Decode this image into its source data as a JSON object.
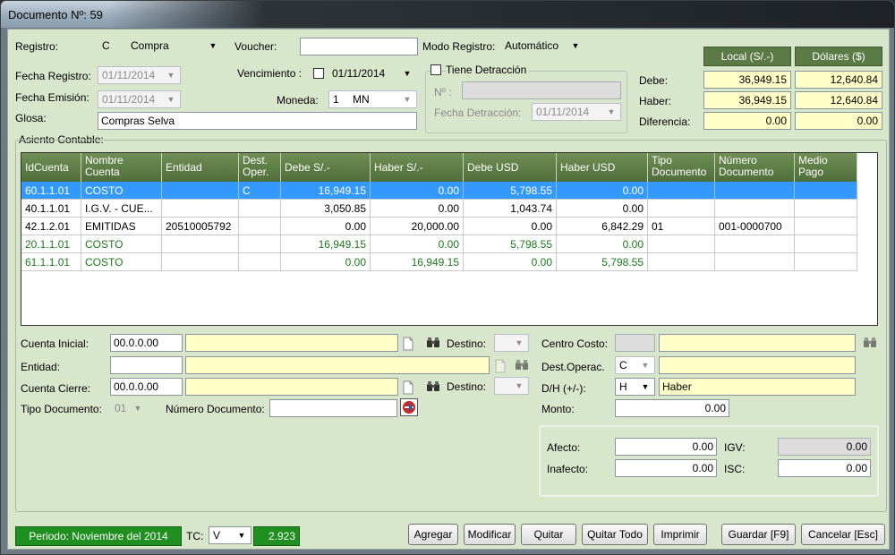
{
  "window": {
    "title": "Documento Nº: 59"
  },
  "header": {
    "registro_label": "Registro:",
    "registro_code": "C",
    "registro_value": "Compra",
    "voucher_label": "Voucher:",
    "voucher_value": "",
    "modo_label": "Modo Registro:",
    "modo_value": "Automático",
    "fecha_registro_label": "Fecha Registro:",
    "fecha_registro_value": "01/11/2014",
    "vencimiento_label": "Vencimiento :",
    "vencimiento_value": "01/11/2014",
    "fecha_emision_label": "Fecha Emisión:",
    "fecha_emision_value": "01/11/2014",
    "moneda_label": "Moneda:",
    "moneda_code": "1",
    "moneda_value": "MN",
    "glosa_label": "Glosa:",
    "glosa_value": "Compras Selva",
    "detraccion_label": "Tiene Detracción",
    "detraccion_no_label": "Nº :",
    "detraccion_no_value": "",
    "fecha_detraccion_label": "Fecha Detracción:",
    "fecha_detraccion_value": "01/11/2014"
  },
  "totals": {
    "col_local": "Local (S/.-)",
    "col_usd": "Dólares ($)",
    "rows": [
      {
        "label": "Debe:",
        "local": "36,949.15",
        "usd": "12,640.84"
      },
      {
        "label": "Haber:",
        "local": "36,949.15",
        "usd": "12,640.84"
      },
      {
        "label": "Diferencia:",
        "local": "0.00",
        "usd": "0.00"
      }
    ]
  },
  "asiento": {
    "label": "Asiento Contable:",
    "columns": [
      "IdCuenta",
      "Nombre\nCuenta",
      "Entidad",
      "Dest.\nOper.",
      "Debe S/.-",
      "Haber S/.-",
      "Debe USD",
      "Haber USD",
      "Tipo\nDocumento",
      "Número\nDocumento",
      "Medio\nPago"
    ],
    "rows": [
      {
        "id": "60.1.1.01",
        "nombre": "COSTO",
        "entidad": "",
        "dest": "C",
        "debe_s": "16,949.15",
        "haber_s": "0.00",
        "debe_usd": "5,798.55",
        "haber_usd": "0.00",
        "tipo": "",
        "numero": "",
        "medio": ""
      },
      {
        "id": "40.1.1.01",
        "nombre": "I.G.V. - CUE...",
        "entidad": "",
        "dest": "",
        "debe_s": "3,050.85",
        "haber_s": "0.00",
        "debe_usd": "1,043.74",
        "haber_usd": "0.00",
        "tipo": "",
        "numero": "",
        "medio": ""
      },
      {
        "id": "42.1.2.01",
        "nombre": "EMITIDAS",
        "entidad": "20510005792",
        "dest": "",
        "debe_s": "0.00",
        "haber_s": "20,000.00",
        "debe_usd": "0.00",
        "haber_usd": "6,842.29",
        "tipo": "01",
        "numero": "001-0000700",
        "medio": ""
      },
      {
        "id": "20.1.1.01",
        "nombre": "COSTO",
        "entidad": "",
        "dest": "",
        "debe_s": "16,949.15",
        "haber_s": "0.00",
        "debe_usd": "5,798.55",
        "haber_usd": "0.00",
        "tipo": "",
        "numero": "",
        "medio": ""
      },
      {
        "id": "61.1.1.01",
        "nombre": "COSTO",
        "entidad": "",
        "dest": "",
        "debe_s": "0.00",
        "haber_s": "16,949.15",
        "debe_usd": "0.00",
        "haber_usd": "5,798.55",
        "tipo": "",
        "numero": "",
        "medio": ""
      }
    ]
  },
  "detail": {
    "cuenta_inicial_label": "Cuenta Inicial:",
    "cuenta_inicial_value": "00.0.0.00",
    "entidad_label": "Entidad:",
    "entidad_value": "",
    "cuenta_cierre_label": "Cuenta Cierre:",
    "cuenta_cierre_value": "00.0.0.00",
    "tipo_doc_label": "Tipo Documento:",
    "tipo_doc_value": "01",
    "numero_doc_label": "Número Documento:",
    "numero_doc_value": "",
    "destino_label": "Destino:",
    "centro_costo_label": "Centro Costo:",
    "dest_operac_label": "Dest.Operac.",
    "dest_operac_value": "C",
    "dh_label": "D/H (+/-):",
    "dh_value": "H",
    "dh_text": "Haber",
    "monto_label": "Monto:",
    "monto_value": "0.00",
    "afecto_label": "Afecto:",
    "afecto_value": "0.00",
    "inafecto_label": "Inafecto:",
    "inafecto_value": "0.00",
    "igv_label": "IGV:",
    "igv_value": "0.00",
    "isc_label": "ISC:",
    "isc_value": "0.00"
  },
  "footer": {
    "periodo": "Periodo: Noviembre del 2014",
    "tc_label": "TC:",
    "tc_value": "V",
    "tc_rate": "2.923",
    "buttons": {
      "agregar": "Agregar",
      "modificar": "Modificar",
      "quitar": "Quitar",
      "quitar_todo": "Quitar Todo",
      "imprimir": "Imprimir",
      "guardar": "Guardar [F9]",
      "cancelar": "Cancelar [Esc]"
    }
  },
  "icons": [
    "binoculars-icon",
    "document-icon",
    "search-document-icon",
    "dropdown-arrow-icon",
    "checkbox-icon"
  ],
  "colors": {
    "grid_header": "#5b7a45",
    "selected_row": "#3399ff",
    "green_text": "#1d7a1d",
    "yellow_field": "#ffffc8",
    "status_green": "#1f8f1f",
    "panel_bg": "#d8e6cc"
  }
}
